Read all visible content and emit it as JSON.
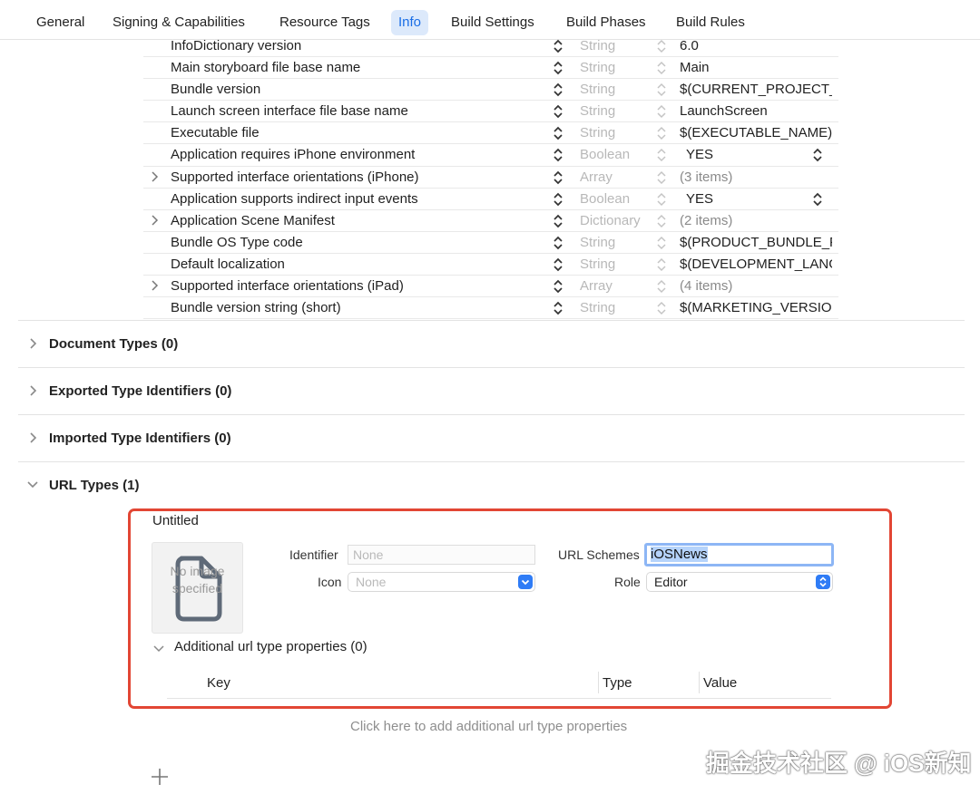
{
  "tabs": [
    {
      "label": "General"
    },
    {
      "label": "Signing & Capabilities"
    },
    {
      "label": "Resource Tags"
    },
    {
      "label": "Info"
    },
    {
      "label": "Build Settings"
    },
    {
      "label": "Build Phases"
    },
    {
      "label": "Build Rules"
    }
  ],
  "plist_rows": [
    {
      "key": "InfoDictionary version",
      "type": "String",
      "value": "6.0"
    },
    {
      "key": "Main storyboard file base name",
      "type": "String",
      "value": "Main"
    },
    {
      "key": "Bundle version",
      "type": "String",
      "value": "$(CURRENT_PROJECT_VERSION)"
    },
    {
      "key": "Launch screen interface file base name",
      "type": "String",
      "value": "LaunchScreen"
    },
    {
      "key": "Executable file",
      "type": "String",
      "value": "$(EXECUTABLE_NAME)"
    },
    {
      "key": "Application requires iPhone environment",
      "type": "Boolean",
      "value": "YES"
    },
    {
      "key": "Supported interface orientations (iPhone)",
      "type": "Array",
      "value": "(3 items)"
    },
    {
      "key": "Application supports indirect input events",
      "type": "Boolean",
      "value": "YES"
    },
    {
      "key": "Application Scene Manifest",
      "type": "Dictionary",
      "value": "(2 items)"
    },
    {
      "key": "Bundle OS Type code",
      "type": "String",
      "value": "$(PRODUCT_BUNDLE_PACKAGE_TYPE)"
    },
    {
      "key": "Default localization",
      "type": "String",
      "value": "$(DEVELOPMENT_LANGUAGE)"
    },
    {
      "key": "Supported interface orientations (iPad)",
      "type": "Array",
      "value": "(4 items)"
    },
    {
      "key": "Bundle version string (short)",
      "type": "String",
      "value": "$(MARKETING_VERSION)"
    }
  ],
  "sections": {
    "document_types": "Document Types (0)",
    "exported_types": "Exported Type Identifiers (0)",
    "imported_types": "Imported Type Identifiers (0)",
    "url_types": "URL Types (1)"
  },
  "url_type": {
    "name": "Untitled",
    "no_image_text": "No image specified",
    "identifier_label": "Identifier",
    "identifier_placeholder": "None",
    "icon_label": "Icon",
    "icon_value": "None",
    "url_schemes_label": "URL Schemes",
    "url_schemes_value": "iOSNews",
    "role_label": "Role",
    "role_value": "Editor",
    "additional_props": "Additional url type properties (0)",
    "col_key": "Key",
    "col_type": "Type",
    "col_value": "Value",
    "add_hint": "Click here to add additional url type properties"
  },
  "watermark": "掘金技术社区 @ iOS新知",
  "colors": {
    "accent": "#1a6ee6",
    "highlight_border": "#e24634",
    "selection": "#b5d3fb"
  }
}
